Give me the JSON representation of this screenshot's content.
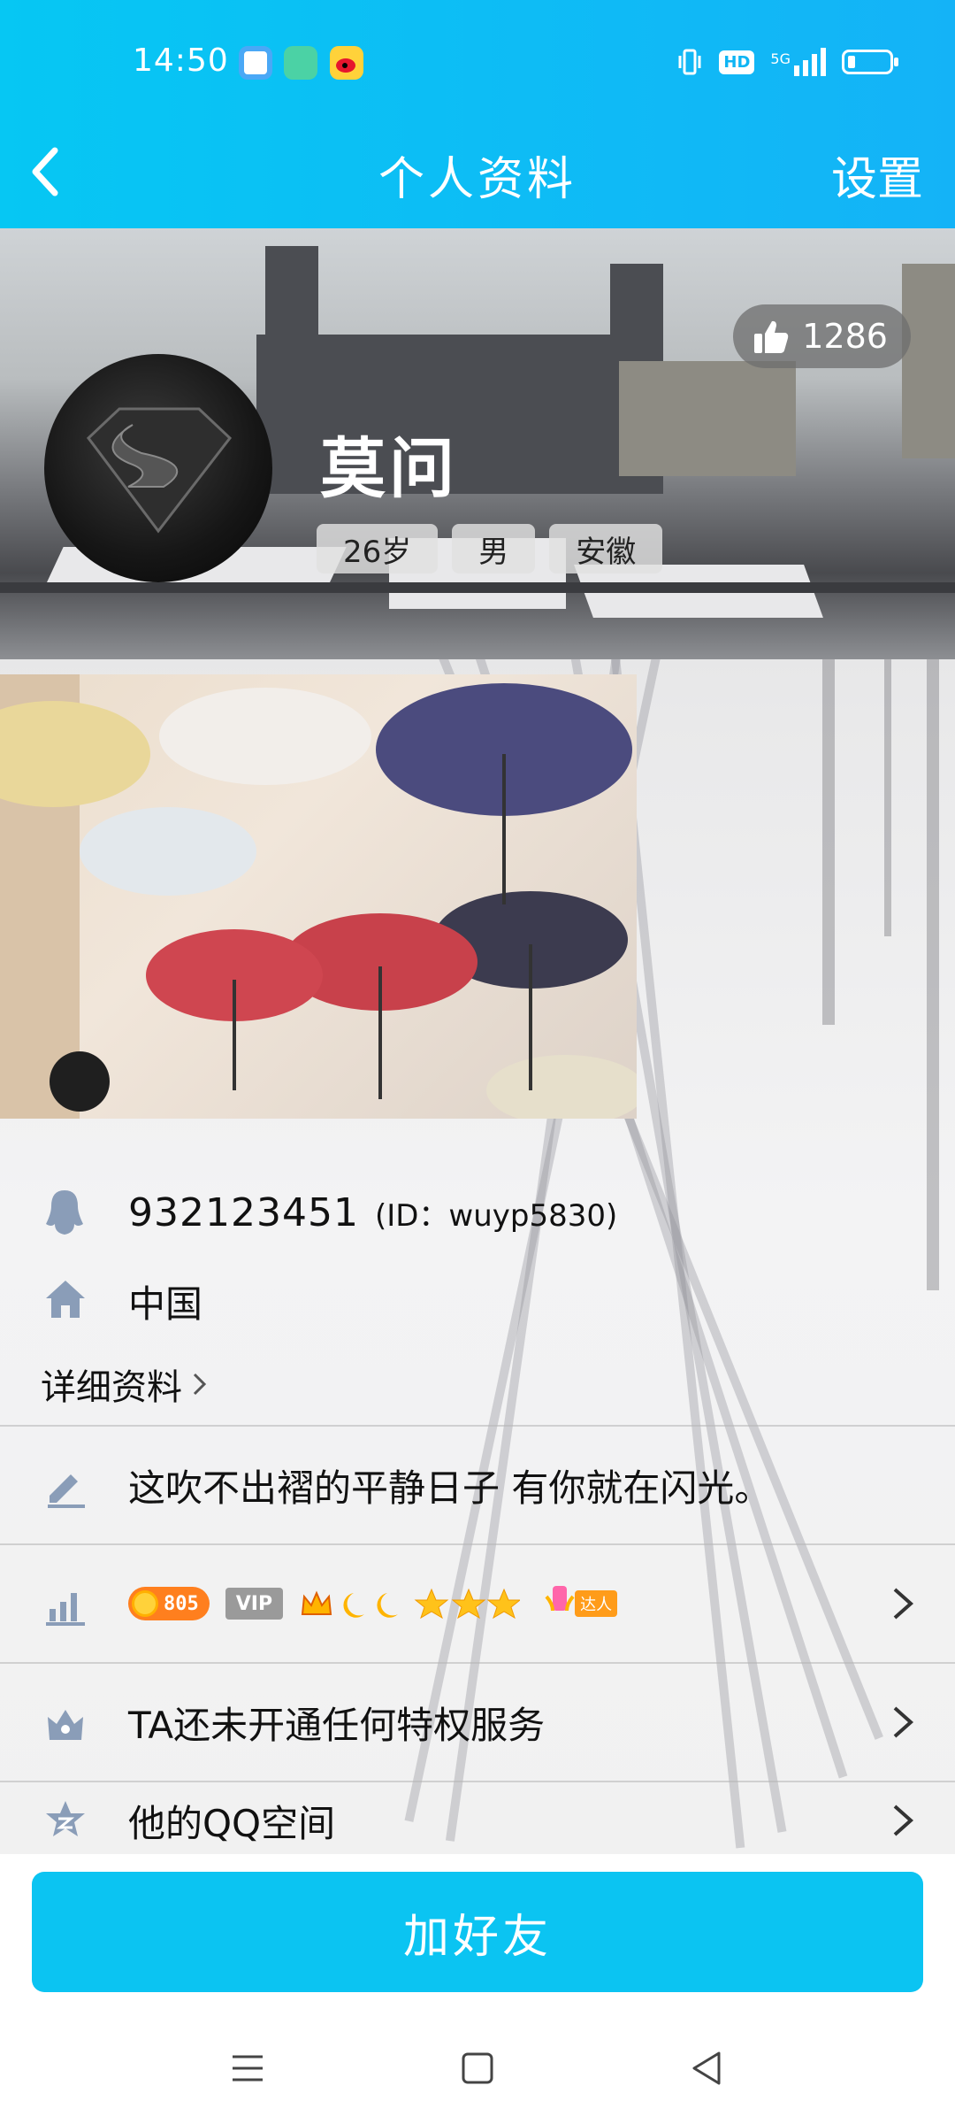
{
  "status_bar": {
    "time": "14:50",
    "network": "5G",
    "hd": "HD"
  },
  "header": {
    "title": "个人资料",
    "settings_label": "设置"
  },
  "profile": {
    "likes": "1286",
    "nickname": "莫问",
    "tags": [
      "26岁",
      "男",
      "安徽"
    ]
  },
  "info": {
    "qq_number": "932123451",
    "qq_id": "(ID：wuyp5830)",
    "country": "中国",
    "detail_link": "详细资料"
  },
  "rows": {
    "signature": "这吹不出褶的平静日子 有你就在闪光。",
    "level_coin": "805",
    "level_vip": "VIP",
    "level_expert": "达人",
    "privilege": "TA还未开通任何特权服务",
    "qzone": "他的QQ空间"
  },
  "actions": {
    "add_friend": "加好友"
  },
  "colors": {
    "brand": "#0bc4f2",
    "coin": "#ff7f1e"
  }
}
